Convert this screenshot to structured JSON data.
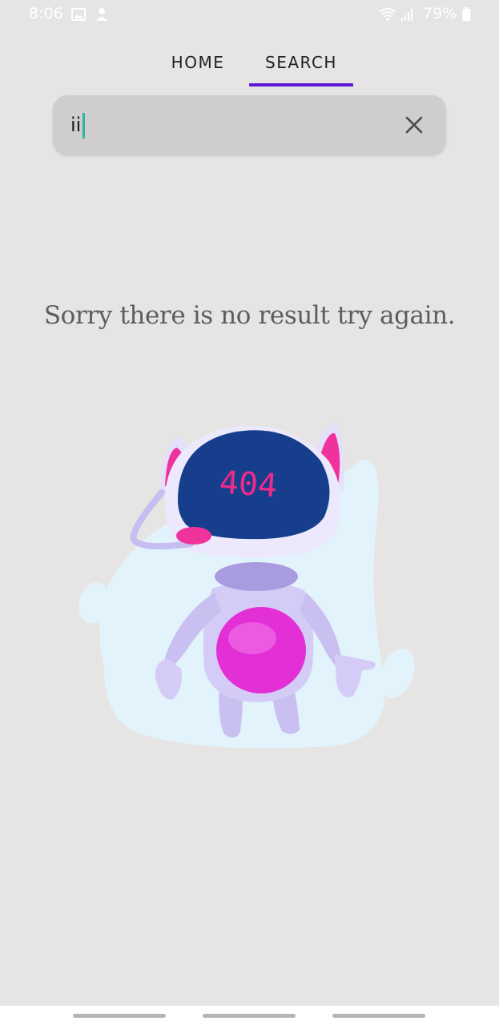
{
  "status_bar": {
    "time": "8:06",
    "battery": "79%",
    "icons": [
      "gallery-icon",
      "notification-icon",
      "wifi-icon",
      "signal-icon",
      "battery-icon"
    ]
  },
  "tabs": [
    {
      "label": "HOME",
      "active": false
    },
    {
      "label": "SEARCH",
      "active": true
    }
  ],
  "search": {
    "value": "ii",
    "clear_icon": "close-icon"
  },
  "message": "Sorry there is no result try again.",
  "illustration": {
    "text": "404"
  },
  "colors": {
    "background": "#e6e5e3",
    "accent": "#5e17d4",
    "caret": "#2cb3a3",
    "message_text": "#5d5d5d"
  }
}
